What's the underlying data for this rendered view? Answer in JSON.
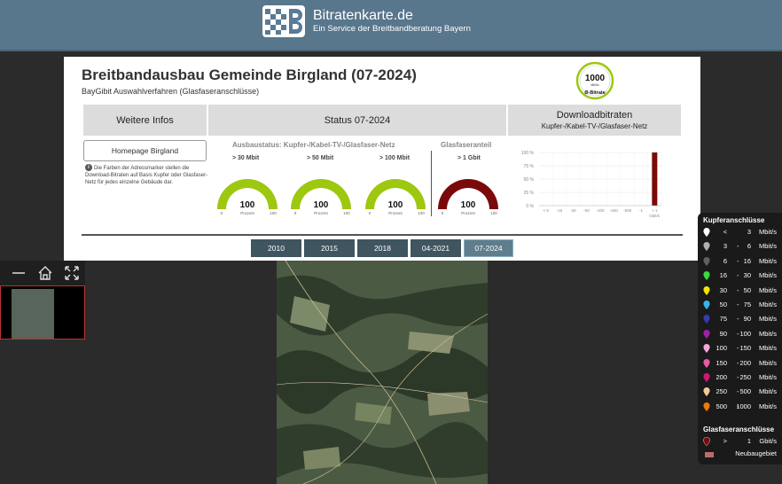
{
  "header": {
    "brand_title": "Bitratenkarte.de",
    "brand_subtitle": "Ein Service der Breitbandberatung Bayern",
    "bg_color": "#58768c"
  },
  "panel": {
    "title": "Breitbandausbau Gemeinde Birgland (07-2024)",
    "subtitle": "BayGibit Auswahlverfahren (Glasfaseranschlüsse)",
    "badge": {
      "value": "1000",
      "unit": "Mbit/s",
      "label": "Ø-Bitrate"
    },
    "col_weitere": "Weitere Infos",
    "col_status": "Status 07-2024",
    "col_download": "Downloadbitraten",
    "col_download_sub": "Kupfer-/Kabel-TV-/Glasfaser-Netz",
    "homepage_button": "Homepage Birgland",
    "info_text": "Die Farben der Adressmarker stellen die Download-Bitraten auf Basis Kupfer oder Glasfaser-Netz für jedes einzelne Gebäude dar.",
    "group_copper": "Ausbaustatus: Kupfer-/Kabel-TV-/Glasfaser-Netz",
    "group_fiber": "Glasfaseranteil",
    "gauges": [
      {
        "label": "> 30 Mbit",
        "value": "100",
        "unit": "Prozent",
        "min": "0",
        "max": "100",
        "color": "#9ec70f"
      },
      {
        "label": "> 50 Mbit",
        "value": "100",
        "unit": "Prozent",
        "min": "0",
        "max": "100",
        "color": "#9ec70f"
      },
      {
        "label": "> 100 Mbit",
        "value": "100",
        "unit": "Prozent",
        "min": "0",
        "max": "100",
        "color": "#9ec70f"
      },
      {
        "label": "> 1 Gbit",
        "value": "100",
        "unit": "Prozent",
        "min": "0",
        "max": "100",
        "color": "#7a0a0a"
      }
    ]
  },
  "chart_data": {
    "type": "bar",
    "title": "",
    "xlabel": "Gbit/s",
    "ylabel": "",
    "ylim": [
      0,
      100
    ],
    "y_ticks": [
      "100 %",
      "75 %",
      "50 %",
      "25 %",
      "0 %"
    ],
    "categories": [
      "< 6",
      "-16",
      "-30",
      "-50",
      "-100",
      "-250",
      "-500",
      "-1",
      "> 1"
    ],
    "values": [
      0,
      0,
      0,
      0,
      0,
      0,
      0,
      0,
      100
    ],
    "bar_color": "#7a0a0a",
    "grid": true
  },
  "years": {
    "items": [
      "2010",
      "2015",
      "2018",
      "04-2021",
      "07-2024"
    ],
    "active": "07-2024"
  },
  "legend": {
    "title": "Kupferanschlüsse",
    "rows": [
      {
        "lo": "<",
        "hi": "3",
        "unit": "Mbit/s",
        "color": "#ffffff"
      },
      {
        "lo": "3",
        "hi": "6",
        "unit": "Mbit/s",
        "color": "#b0b0b0"
      },
      {
        "lo": "6",
        "hi": "16",
        "unit": "Mbit/s",
        "color": "#606060"
      },
      {
        "lo": "16",
        "hi": "30",
        "unit": "Mbit/s",
        "color": "#3ed83e"
      },
      {
        "lo": "30",
        "hi": "50",
        "unit": "Mbit/s",
        "color": "#f2e600"
      },
      {
        "lo": "50",
        "hi": "75",
        "unit": "Mbit/s",
        "color": "#35b6e6"
      },
      {
        "lo": "75",
        "hi": "90",
        "unit": "Mbit/s",
        "color": "#3a3aa8"
      },
      {
        "lo": "90",
        "hi": "100",
        "unit": "Mbit/s",
        "color": "#a020a8"
      },
      {
        "lo": "100",
        "hi": "150",
        "unit": "Mbit/s",
        "color": "#f2a8d6"
      },
      {
        "lo": "150",
        "hi": "200",
        "unit": "Mbit/s",
        "color": "#e85aa8"
      },
      {
        "lo": "200",
        "hi": "250",
        "unit": "Mbit/s",
        "color": "#d01870"
      },
      {
        "lo": "250",
        "hi": "500",
        "unit": "Mbit/s",
        "color": "#f5c898"
      },
      {
        "lo": "500",
        "hi": "1000",
        "unit": "Mbit/s",
        "color": "#e87a10"
      }
    ],
    "fiber_title": "Glasfaseranschlüsse",
    "fiber_row": {
      "lo": ">",
      "hi": "1",
      "unit": "Gbit/s",
      "color": "#7a0a0a"
    },
    "neubau_label": "Neubaugebiet"
  }
}
